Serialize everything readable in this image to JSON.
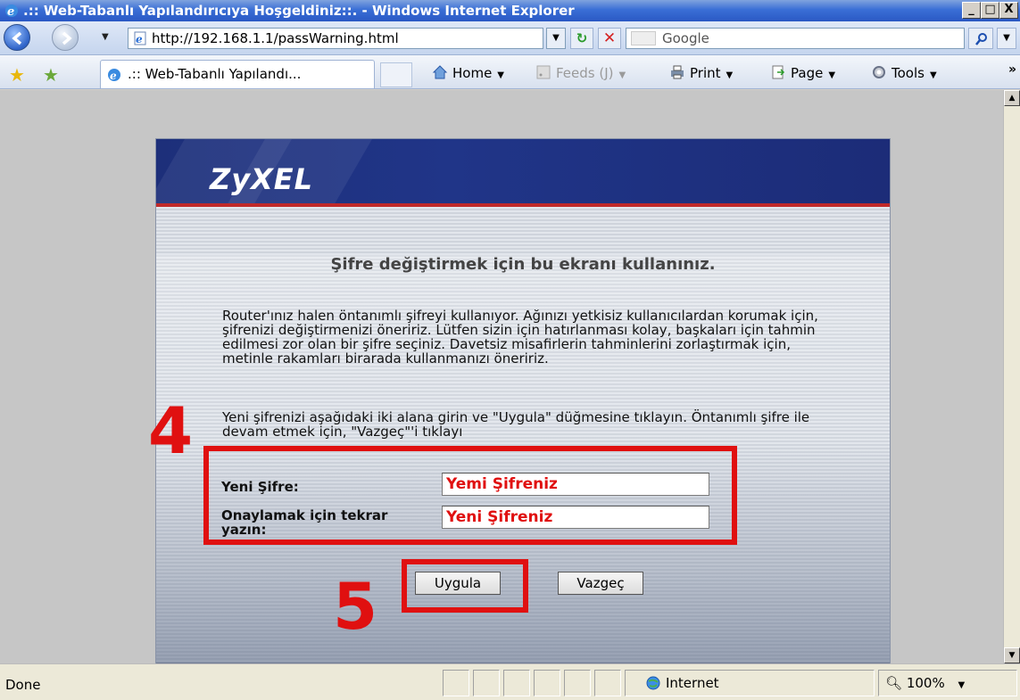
{
  "window": {
    "title": ".:: Web-Tabanlı Yapılandırıcıya Hoşgeldiniz::. - Windows Internet Explorer",
    "minimize": "_",
    "maximize": "□",
    "close": "X"
  },
  "addressbar": {
    "url": "http://192.168.1.1/passWarning.html",
    "search_placeholder": "Google"
  },
  "tab": {
    "label": ".:: Web-Tabanlı Yapılandı..."
  },
  "commands": {
    "home": "Home",
    "feeds": "Feeds (J)",
    "print": "Print",
    "page": "Page",
    "tools": "Tools"
  },
  "page": {
    "logo": "ZyXEL",
    "title": "Şifre değiştirmek için bu ekranı kullanınız.",
    "intro": "Router'ınız halen öntanımlı şifreyi kullanıyor. Ağınızı yetkisiz kullanıcılardan korumak için, şifrenizi değiştirmenizi öneririz. Lütfen sizin için hatırlanması kolay, başkaları için tahmin edilmesi zor olan bir şifre seçiniz. Davetsiz misafirlerin tahminlerini zorlaştırmak için, metinle rakamları birarada kullanmanızı öneririz.",
    "instruction": "Yeni şifrenizi aşağıdaki iki alana girin ve \"Uygula\" düğmesine tıklayın. Öntanımlı şifre ile devam etmek için, \"Vazgeç\"'i tıklayı",
    "new_password_label": "Yeni Şifre:",
    "new_password_value": "Yemi Şifreniz",
    "confirm_label": "Onaylamak için tekrar yazın:",
    "confirm_value": "Yeni Şifreniz",
    "apply_button": "Uygula",
    "cancel_button": "Vazgeç"
  },
  "annotations": {
    "step_fields": "4",
    "step_apply": "5",
    "color": "#e01010"
  },
  "status": {
    "text": "Done",
    "zone": "Internet",
    "zoom": "100%"
  },
  "colors": {
    "header_blue": "#1d2f7a",
    "header_stripe": "#c02a2a",
    "titlebar_blue": "#2a58c4"
  }
}
